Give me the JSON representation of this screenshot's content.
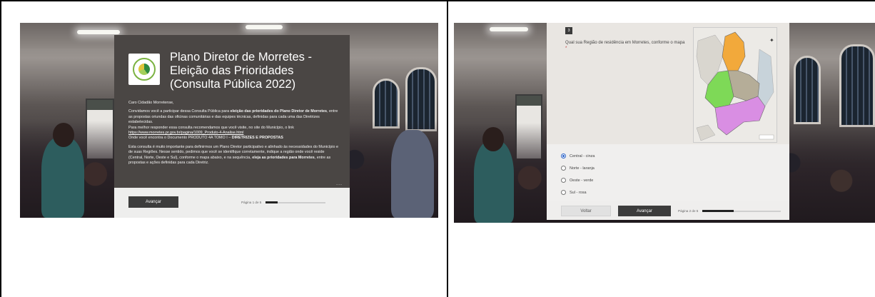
{
  "left_panel": {
    "form_title": "Plano Diretor de Morretes - Eleição das Prioridades (Consulta Pública 2022)",
    "greeting": "Caro Cidadão Morretense,",
    "intro_before_bold": "Convidamos você a participar dessa Consulta Pública para ",
    "intro_bold": "eleição das prioridades do Plano Diretor de Morretes",
    "intro_after_bold": ", entre as propostas oriundas das oficinas comunitárias e das equipes técnicas, definidas para cada uma das Diretrizes estabelecidas.",
    "recommend": "Para melhor responder essa consulta recomendamos que você visite, no site do Município, o link",
    "link": "https://www.morretes.pr.gov.br/pagina/1009_Produto-4-Analise.html",
    "doc_before_bold": "Onde você encontra o Documento PRODUTO 4A TOMO I – ",
    "doc_bold": "DIRETRIZES E PROPOSTAS",
    "para2_before_bold": "Esta consulta é muito importante para definirmos um Plano Diretor participativo e alinhado às necessidades do Município e de suas Regiões. Nesse sentido, pedimos que você se identifique corretamente, indique a região onde você reside (Central, Norte, Oeste e Sul), conforme o mapa abaixo, e na sequência, ",
    "para2_bold_1": "eleja as prioridades para Morretes",
    "para2_after_bold": ", entre as propostas e ações definidas para cada Diretriz.",
    "ellipsis": "...",
    "next_button": "Avançar",
    "page_indicator": "Página 1 de 5",
    "progress": 0.2
  },
  "right_panel": {
    "question_number": "3",
    "question_text": "Qual sua Região de residência em Morretes, conforme o mapa",
    "required_mark": "*",
    "options": [
      {
        "label": "Central - cinza",
        "selected": true
      },
      {
        "label": "Norte - laranja",
        "selected": false
      },
      {
        "label": "Oeste - verde",
        "selected": false
      },
      {
        "label": "Sul - rosa",
        "selected": false
      }
    ],
    "back_button": "Voltar",
    "next_button": "Avançar",
    "page_indicator": "Página 2 de 5",
    "progress": 0.4
  },
  "colors": {
    "card_bg": "#4a4644",
    "button_dark": "#3c3c3c",
    "radio_selected": "#2b63c9",
    "region_central": "#b5ad98",
    "region_norte": "#f2a93b",
    "region_oeste": "#7ed957",
    "region_sul": "#d98ee3"
  }
}
